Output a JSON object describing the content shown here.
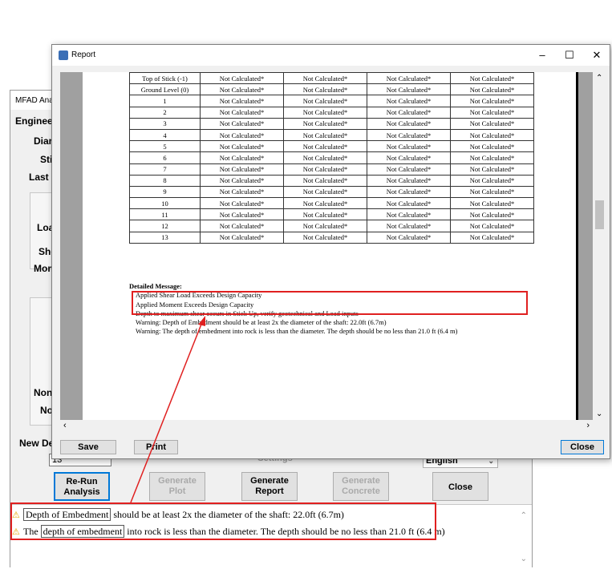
{
  "background_window": {
    "title": "MFAD Anal",
    "labels": [
      "Engineer",
      "Diar",
      "Sti",
      "Last D",
      "Loa",
      "She",
      "Mom",
      "Non",
      "No",
      "New De"
    ],
    "input_value": "13",
    "settings_label": "Settings",
    "language_value": "English",
    "buttons": {
      "rerun": "Re-Run\nAnalysis",
      "plot": "Generate\nPlot",
      "report": "Generate\nReport",
      "concrete": "Generate\nConcrete",
      "close": "Close"
    },
    "messages": [
      {
        "boxed": "Depth of Embedment",
        "rest": " should be at least 2x the diameter of the shaft: 22.0ft (6.7m)"
      },
      {
        "pre": "The ",
        "boxed": "depth of embedment",
        "rest": " into rock is less than the diameter. The depth should be no less than 21.0 ft (6.4 m)"
      }
    ]
  },
  "report_window": {
    "title": "Report",
    "buttons": {
      "save": "Save",
      "print": "Print",
      "close": "Close"
    },
    "table": {
      "rows": [
        {
          "label": "Top of Stick (-1)",
          "values": [
            "Not Calculated*",
            "Not Calculated*",
            "Not Calculated*",
            "Not Calculated*"
          ]
        },
        {
          "label": "Ground Level (0)",
          "values": [
            "Not Calculated*",
            "Not Calculated*",
            "Not Calculated*",
            "Not Calculated*"
          ]
        },
        {
          "label": "1",
          "values": [
            "Not Calculated*",
            "Not Calculated*",
            "Not Calculated*",
            "Not Calculated*"
          ]
        },
        {
          "label": "2",
          "values": [
            "Not Calculated*",
            "Not Calculated*",
            "Not Calculated*",
            "Not Calculated*"
          ]
        },
        {
          "label": "3",
          "values": [
            "Not Calculated*",
            "Not Calculated*",
            "Not Calculated*",
            "Not Calculated*"
          ]
        },
        {
          "label": "4",
          "values": [
            "Not Calculated*",
            "Not Calculated*",
            "Not Calculated*",
            "Not Calculated*"
          ]
        },
        {
          "label": "5",
          "values": [
            "Not Calculated*",
            "Not Calculated*",
            "Not Calculated*",
            "Not Calculated*"
          ]
        },
        {
          "label": "6",
          "values": [
            "Not Calculated*",
            "Not Calculated*",
            "Not Calculated*",
            "Not Calculated*"
          ]
        },
        {
          "label": "7",
          "values": [
            "Not Calculated*",
            "Not Calculated*",
            "Not Calculated*",
            "Not Calculated*"
          ]
        },
        {
          "label": "8",
          "values": [
            "Not Calculated*",
            "Not Calculated*",
            "Not Calculated*",
            "Not Calculated*"
          ]
        },
        {
          "label": "9",
          "values": [
            "Not Calculated*",
            "Not Calculated*",
            "Not Calculated*",
            "Not Calculated*"
          ]
        },
        {
          "label": "10",
          "values": [
            "Not Calculated*",
            "Not Calculated*",
            "Not Calculated*",
            "Not Calculated*"
          ]
        },
        {
          "label": "11",
          "values": [
            "Not Calculated*",
            "Not Calculated*",
            "Not Calculated*",
            "Not Calculated*"
          ]
        },
        {
          "label": "12",
          "values": [
            "Not Calculated*",
            "Not Calculated*",
            "Not Calculated*",
            "Not Calculated*"
          ]
        },
        {
          "label": "13",
          "values": [
            "Not Calculated*",
            "Not Calculated*",
            "Not Calculated*",
            "Not Calculated*"
          ]
        }
      ]
    },
    "detailed_message": {
      "heading": "Detailed Message:",
      "lines": [
        "Applied Shear Load Exceeds Design Capacity",
        "Applied Moment Exceeds Design Capacity",
        "Depth to maximum shear occurs in Stick Up, verify geotechnical and Load inputs",
        "Warning: Depth of Embedment should be at least 2x the diameter of the shaft: 22.0ft (6.7m)",
        "Warning: The depth of embedment into rock is less than the diameter.  The depth should be no less than 21.0 ft (6.4 m)"
      ]
    }
  },
  "colors": {
    "annotation": "#e02020",
    "warning_icon": "#e6a800",
    "focus_border": "#0078d7"
  },
  "icons": [
    "report-app-icon",
    "minimize-icon",
    "maximize-icon",
    "close-icon",
    "warning-icon",
    "scroll-arrow-icon"
  ]
}
